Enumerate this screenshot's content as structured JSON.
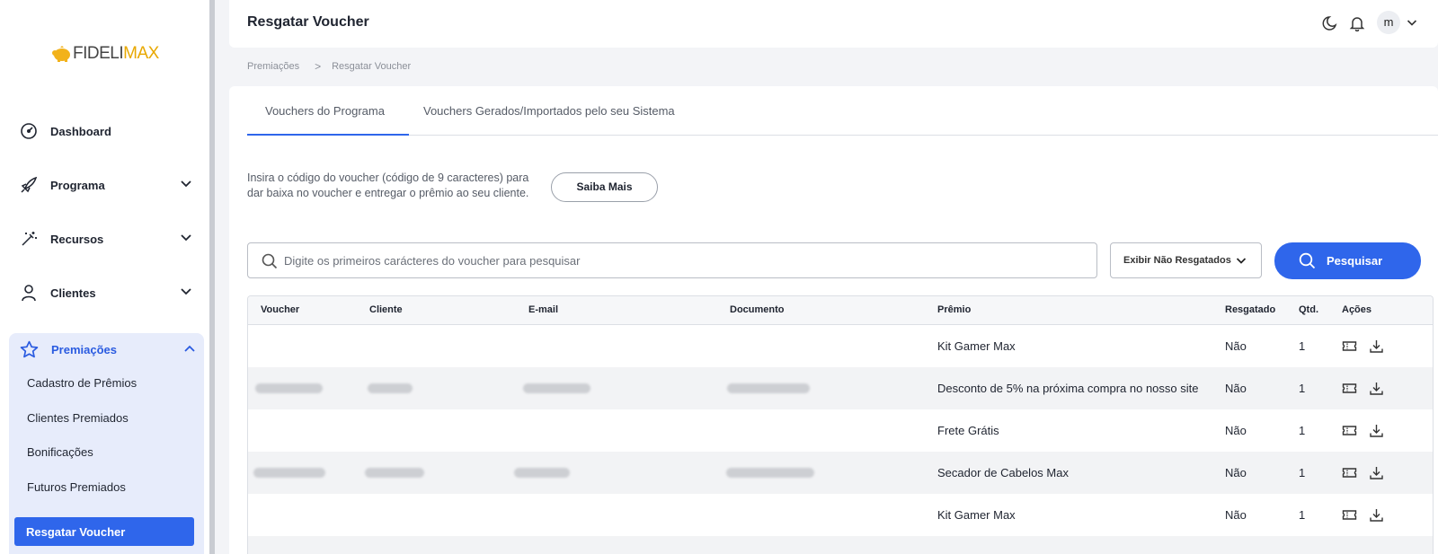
{
  "sidebar": {
    "logo": {
      "part1": "FIDELI",
      "part2": "MAX"
    },
    "items": [
      {
        "label": "Dashboard",
        "icon": "gauge-icon"
      },
      {
        "label": "Programa",
        "icon": "rocket-icon"
      },
      {
        "label": "Recursos",
        "icon": "magic-wand-icon"
      },
      {
        "label": "Clientes",
        "icon": "user-icon"
      }
    ],
    "group": {
      "label": "Premiações",
      "icon": "star-icon",
      "subitems": [
        "Cadastro de Prêmios",
        "Clientes Premiados",
        "Bonificações",
        "Futuros Premiados"
      ],
      "active": "Resgatar Voucher"
    }
  },
  "header": {
    "title": "Resgatar Voucher",
    "avatar": "m",
    "icons": [
      "moon-icon",
      "bell-icon",
      "chevron-down-icon"
    ]
  },
  "breadcrumb": {
    "parent": "Premiações",
    "separator": ">",
    "current": "Resgatar Voucher"
  },
  "tabs": [
    "Vouchers do Programa",
    "Vouchers Gerados/Importados pelo seu Sistema"
  ],
  "help_text": "Insira o código do voucher (código de 9 caracteres) para dar baixa no voucher e entregar o prêmio ao seu cliente.",
  "saiba_mais": "Saiba Mais",
  "search": {
    "placeholder": "Digite os primeiros carácteres do voucher para pesquisar"
  },
  "filter": {
    "selected": "Exibir Não Resgatados"
  },
  "search_button": "Pesquisar",
  "table": {
    "headers": [
      "Voucher",
      "Cliente",
      "E-mail",
      "Documento",
      "Prêmio",
      "Resgatado",
      "Qtd.",
      "Ações"
    ],
    "rows": [
      {
        "premio": "Kit Gamer Max",
        "resgatado": "Não",
        "qtd": "1"
      },
      {
        "premio": "Desconto de 5% na próxima compra no nosso site",
        "resgatado": "Não",
        "qtd": "1"
      },
      {
        "premio": "Frete Grátis",
        "resgatado": "Não",
        "qtd": "1"
      },
      {
        "premio": "Secador de Cabelos Max",
        "resgatado": "Não",
        "qtd": "1"
      },
      {
        "premio": "Kit Gamer Max",
        "resgatado": "Não",
        "qtd": "1"
      }
    ],
    "action_icons": [
      "ticket-icon",
      "download-icon"
    ]
  },
  "colors": {
    "primary": "#2f66eb",
    "active_bg": "#e7ecfb",
    "logo_accent": "#e8a800"
  }
}
